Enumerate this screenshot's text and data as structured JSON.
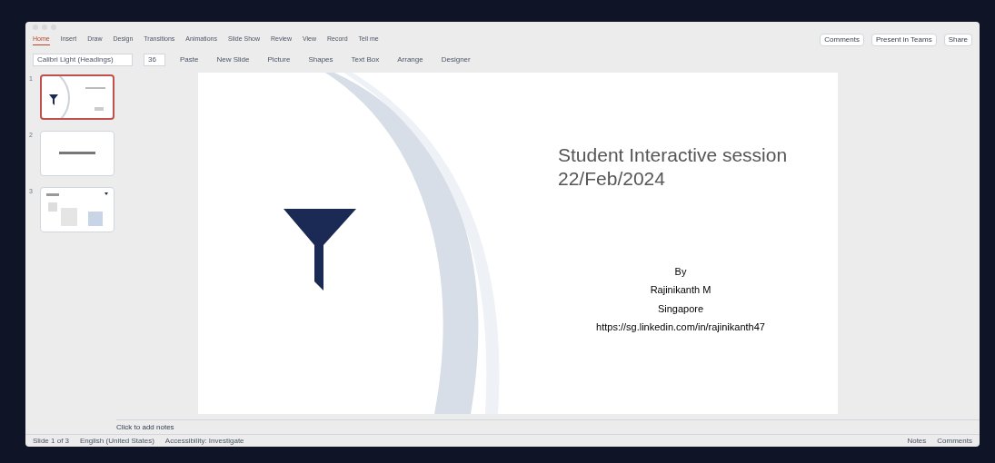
{
  "ribbon_tabs": [
    {
      "label": "Home",
      "selected": true
    },
    {
      "label": "Insert",
      "selected": false
    },
    {
      "label": "Draw",
      "selected": false
    },
    {
      "label": "Design",
      "selected": false
    },
    {
      "label": "Transitions",
      "selected": false
    },
    {
      "label": "Animations",
      "selected": false
    },
    {
      "label": "Slide Show",
      "selected": false
    },
    {
      "label": "Review",
      "selected": false
    },
    {
      "label": "View",
      "selected": false
    },
    {
      "label": "Record",
      "selected": false
    },
    {
      "label": "Tell me",
      "selected": false
    }
  ],
  "header_buttons": [
    "Comments",
    "Present in Teams",
    "Share"
  ],
  "ribbon": {
    "font": "Calibri Light (Headings)",
    "font_size": "36",
    "buttons": [
      "Paste",
      "New Slide",
      "Picture",
      "Shapes",
      "Text Box",
      "Arrange",
      "Designer"
    ]
  },
  "thumbnails": [
    {
      "number": "1",
      "selected": true
    },
    {
      "number": "2",
      "selected": false
    },
    {
      "number": "3",
      "selected": false
    }
  ],
  "slide": {
    "title": "Student Interactive session",
    "date": "22/Feb/2024",
    "credits": [
      "By",
      "Rajinikanth M",
      "Singapore",
      "https://sg.linkedin.com/in/rajinikanth47"
    ]
  },
  "notes": {
    "placeholder": "Click to add notes"
  },
  "status_bar": {
    "left": [
      "Slide 1 of 3",
      "English (United States)",
      "Accessibility: Investigate"
    ],
    "right": [
      "Notes",
      "Comments"
    ]
  }
}
